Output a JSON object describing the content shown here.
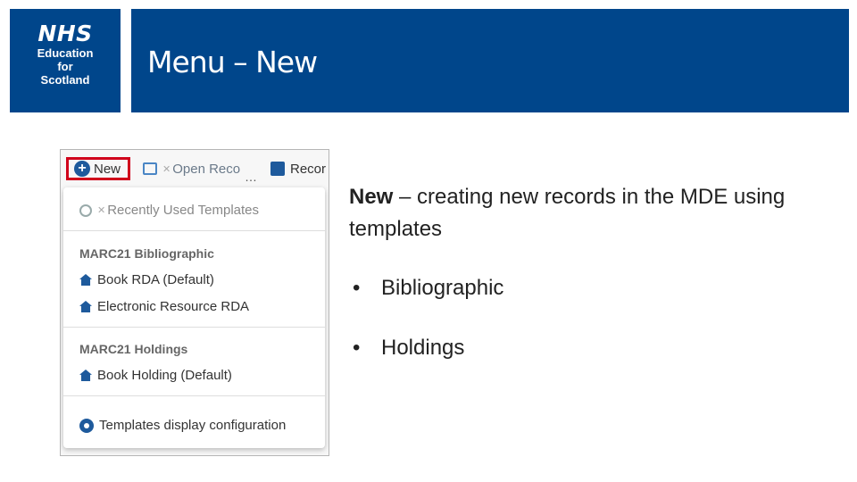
{
  "logo": {
    "line1": "NHS",
    "line2": "Education",
    "line3": "for",
    "line4": "Scotland"
  },
  "slide": {
    "title": "Menu – New"
  },
  "screenshot": {
    "toolbar": {
      "new_label": "New",
      "open_label": "Open Reco",
      "record_label": "Recor"
    },
    "menu": {
      "recent_label": "Recently Used Templates",
      "sections": [
        {
          "heading": "MARC21 Bibliographic",
          "items": [
            "Book RDA (Default)",
            "Electronic Resource RDA"
          ]
        },
        {
          "heading": "MARC21 Holdings",
          "items": [
            "Book Holding (Default)"
          ]
        }
      ],
      "config_label": "Templates display configuration"
    },
    "icons": {
      "new": "plus-circle-icon",
      "open": "open-record-icon",
      "record": "record-list-icon",
      "recent": "history-icon",
      "template": "house-icon",
      "config": "gear-icon"
    }
  },
  "content": {
    "term": "New",
    "description": " – creating new records in the MDE using templates",
    "bullets": [
      "Bibliographic",
      "Holdings"
    ]
  },
  "colors": {
    "brand": "#00468b",
    "highlight": "#d0021b",
    "icon_blue": "#1e5a9c"
  }
}
